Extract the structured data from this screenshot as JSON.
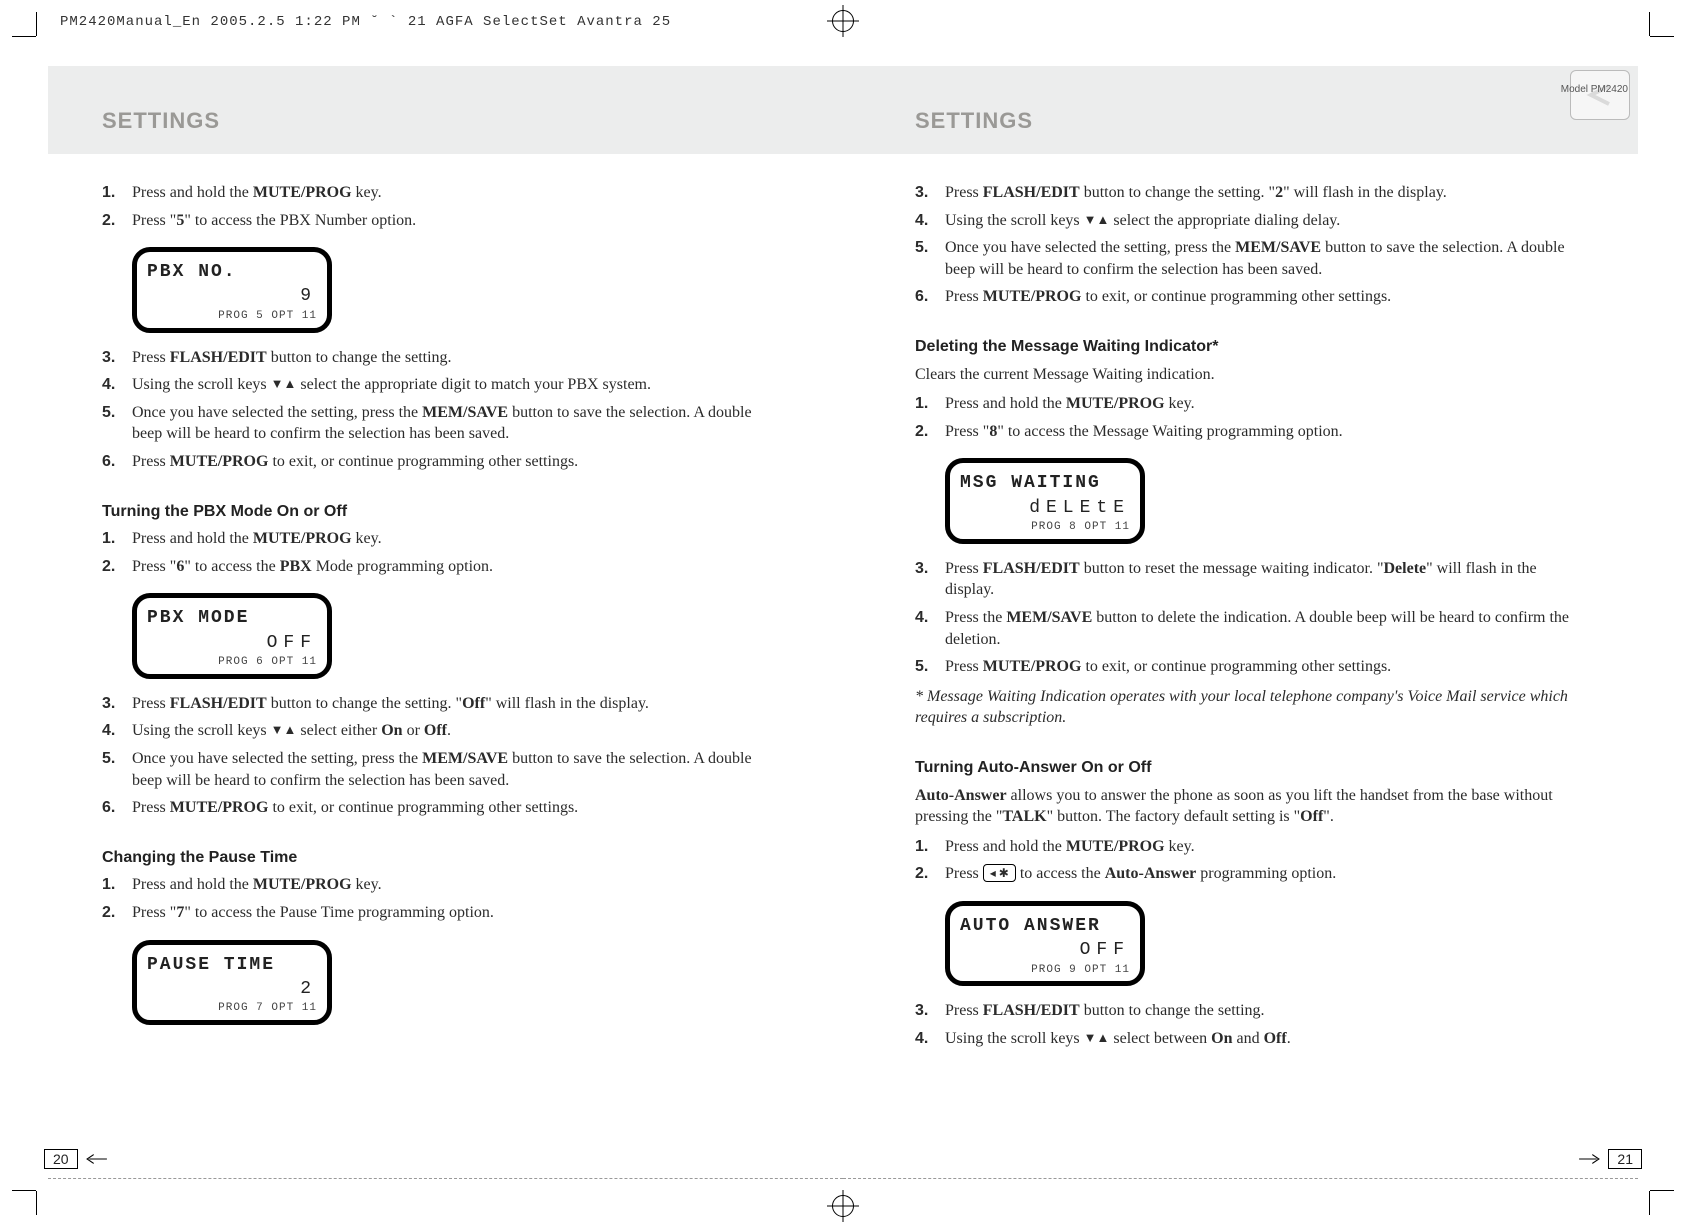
{
  "slug": "PM2420Manual_En  2005.2.5 1:22 PM  ˘  ` 21   AGFA SelectSet Avantra 25",
  "header": {
    "left_title": "SETTINGS",
    "right_title": "SETTINGS",
    "model": "Model PM2420"
  },
  "footer": {
    "left_page": "20",
    "right_page": "21"
  },
  "left": {
    "block1_steps": [
      {
        "n": "1.",
        "html": "Press and hold the <span class='bold'>MUTE/PROG</span> key."
      },
      {
        "n": "2.",
        "html": "Press \"<span class='bold'>5</span>\" to access the PBX Number option."
      }
    ],
    "lcd1": {
      "l1": "PBX NO.",
      "l2": "9",
      "l3": "PROG 5   OPT 11"
    },
    "block2_steps": [
      {
        "n": "3.",
        "html": "Press <span class='bold'>FLASH/EDIT</span> button to change the setting."
      },
      {
        "n": "4.",
        "html": "Using the scroll keys <span class='arrows'>▼▲</span> select the appropriate digit to match your PBX system."
      },
      {
        "n": "5.",
        "html": "Once you have selected the setting, press the <span class='bold'>MEM/SAVE</span> button to save the selection. A double beep will be heard to confirm the selection has been saved."
      },
      {
        "n": "6.",
        "html": "Press <span class='bold'>MUTE/PROG</span> to exit, or continue programming other settings."
      }
    ],
    "h1": "Turning the PBX Mode On or Off",
    "block3_steps": [
      {
        "n": "1.",
        "html": "Press and hold the <span class='bold'>MUTE/PROG</span> key."
      },
      {
        "n": "2.",
        "html": "Press \"<span class='bold'>6</span>\" to access the <span class='bold'>PBX</span> Mode programming option."
      }
    ],
    "lcd2": {
      "l1": "PBX MODE",
      "l2": "OFF",
      "l3": "PROG 6   OPT 11"
    },
    "block4_steps": [
      {
        "n": "3.",
        "html": "Press <span class='bold'>FLASH/EDIT</span> button to change the setting. \"<span class='bold'>Off</span>\" will flash in the display."
      },
      {
        "n": "4.",
        "html": "Using the scroll keys <span class='arrows'>▼▲</span> select either <span class='bold'>On</span> or <span class='bold'>Off</span>."
      },
      {
        "n": "5.",
        "html": "Once you have selected the setting, press the <span class='bold'>MEM/SAVE</span> button to save the selection. A double beep will be heard to confirm the selection has been saved."
      },
      {
        "n": "6.",
        "html": "Press <span class='bold'>MUTE/PROG</span> to exit, or continue programming other settings."
      }
    ],
    "h2": "Changing the Pause Time",
    "block5_steps": [
      {
        "n": "1.",
        "html": "Press and hold the <span class='bold'>MUTE/PROG</span> key."
      },
      {
        "n": "2.",
        "html": "Press \"<span class='bold'>7</span>\" to access the Pause Time programming option."
      }
    ],
    "lcd3": {
      "l1": "PAUSE TIME",
      "l2": "2",
      "l3": "PROG 7   OPT 11"
    }
  },
  "right": {
    "block1_steps": [
      {
        "n": "3.",
        "html": "Press <span class='bold'>FLASH/EDIT</span> button to change the setting. \"<span class='bold'>2</span>\" will flash in the display."
      },
      {
        "n": "4.",
        "html": "Using the scroll keys <span class='arrows'>▼▲</span> select the appropriate dialing delay."
      },
      {
        "n": "5.",
        "html": "Once you have selected the setting, press the <span class='bold'>MEM/SAVE</span> button to save the selection. A double beep will be heard to confirm the selection has been saved."
      },
      {
        "n": "6.",
        "html": "Press <span class='bold'>MUTE/PROG</span> to exit, or continue programming other settings."
      }
    ],
    "h1": "Deleting the Message Waiting Indicator*",
    "lead1": "Clears the current Message Waiting indication.",
    "block2_steps": [
      {
        "n": "1.",
        "html": "Press and hold the <span class='bold'>MUTE/PROG</span> key."
      },
      {
        "n": "2.",
        "html": "Press \"<span class='bold'>8</span>\" to access the Message Waiting programming option."
      }
    ],
    "lcd1": {
      "l1": "MSG WAITING",
      "l2": "dELEtE",
      "l3": "PROG 8   OPT 11"
    },
    "block3_steps": [
      {
        "n": "3.",
        "html": "Press <span class='bold'>FLASH/EDIT</span> button to reset the message waiting indicator. \"<span class='bold'>Delete</span>\" will flash in the display."
      },
      {
        "n": "4.",
        "html": "Press the <span class='bold'>MEM/SAVE</span> button to delete the indication. A double beep will be heard to confirm the deletion."
      },
      {
        "n": "5.",
        "html": "Press <span class='bold'>MUTE/PROG</span> to exit, or continue programming other settings."
      }
    ],
    "note1": "* Message Waiting Indication operates with your local telephone company's Voice Mail service which requires a subscription.",
    "h2": "Turning Auto-Answer On or Off",
    "lead2_html": "<span class='bold'>Auto-Answer</span> allows you to answer the phone as soon as you lift the handset from the base without pressing the \"<span class='bold'>TALK</span>\" button. The factory default setting is \"<span class='bold'>Off</span>\".",
    "block4_steps": [
      {
        "n": "1.",
        "html": "Press and hold the <span class='bold'>MUTE/PROG</span> key."
      },
      {
        "n": "2.",
        "html": "Press <span class='keycap'>◂ ✱</span> to access the <span class='bold'>Auto-Answer</span> programming option."
      }
    ],
    "lcd2": {
      "l1": "AUTO ANSWER",
      "l2": "OFF",
      "l3": "PROG 9   OPT 11"
    },
    "block5_steps": [
      {
        "n": "3.",
        "html": "Press <span class='bold'>FLASH/EDIT</span> button to change the setting."
      },
      {
        "n": "4.",
        "html": "Using the scroll keys <span class='arrows'>▼▲</span> select between <span class='bold'>On</span> and <span class='bold'>Off</span>."
      }
    ]
  }
}
